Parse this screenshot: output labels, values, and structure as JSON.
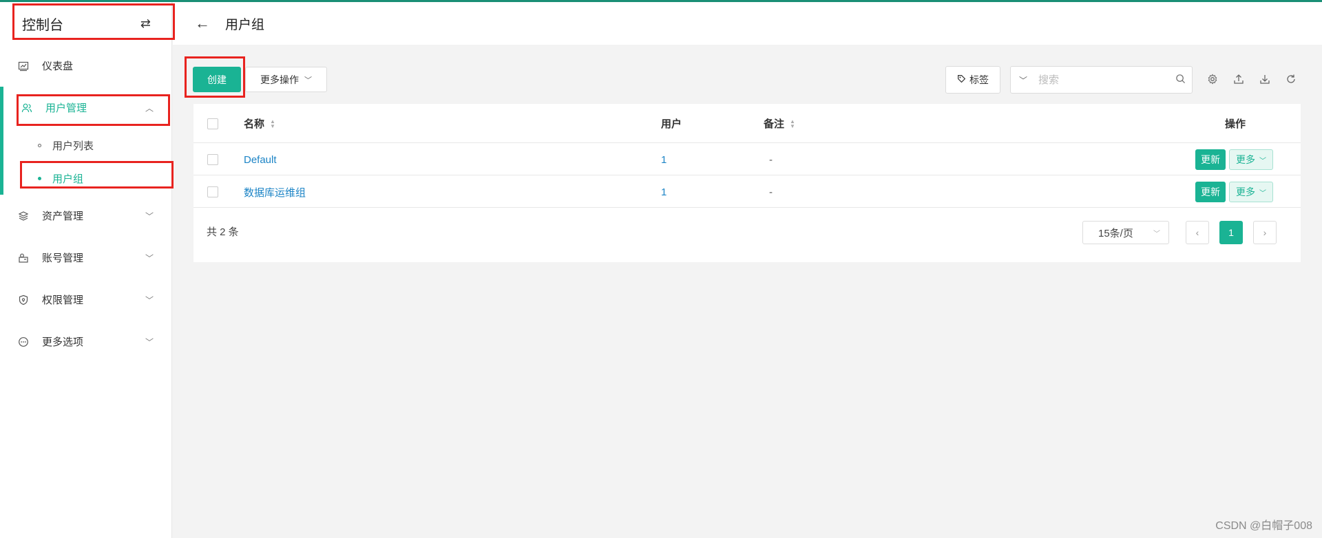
{
  "sidebar": {
    "title": "控制台",
    "items": [
      {
        "label": "仪表盘"
      },
      {
        "label": "用户管理",
        "children": [
          {
            "label": "用户列表"
          },
          {
            "label": "用户组"
          }
        ]
      },
      {
        "label": "资产管理"
      },
      {
        "label": "账号管理"
      },
      {
        "label": "权限管理"
      },
      {
        "label": "更多选项"
      }
    ]
  },
  "header": {
    "title": "用户组"
  },
  "toolbar": {
    "create_label": "创建",
    "more_ops_label": "更多操作",
    "tag_label": "标签",
    "search_placeholder": "搜索"
  },
  "table": {
    "columns": {
      "name": "名称",
      "users": "用户",
      "comment": "备注",
      "actions": "操作"
    },
    "rows": [
      {
        "name": "Default",
        "users": "1",
        "comment": "-",
        "update": "更新",
        "more": "更多"
      },
      {
        "name": "数据库运维组",
        "users": "1",
        "comment": "-",
        "update": "更新",
        "more": "更多"
      }
    ]
  },
  "pagination": {
    "total_text": "共 2 条",
    "page_size": "15条/页",
    "current_page": "1"
  },
  "watermark": "CSDN @白帽子008",
  "colors": {
    "primary": "#1ab394",
    "link": "#1c84c6",
    "annotation": "#e8231f"
  }
}
